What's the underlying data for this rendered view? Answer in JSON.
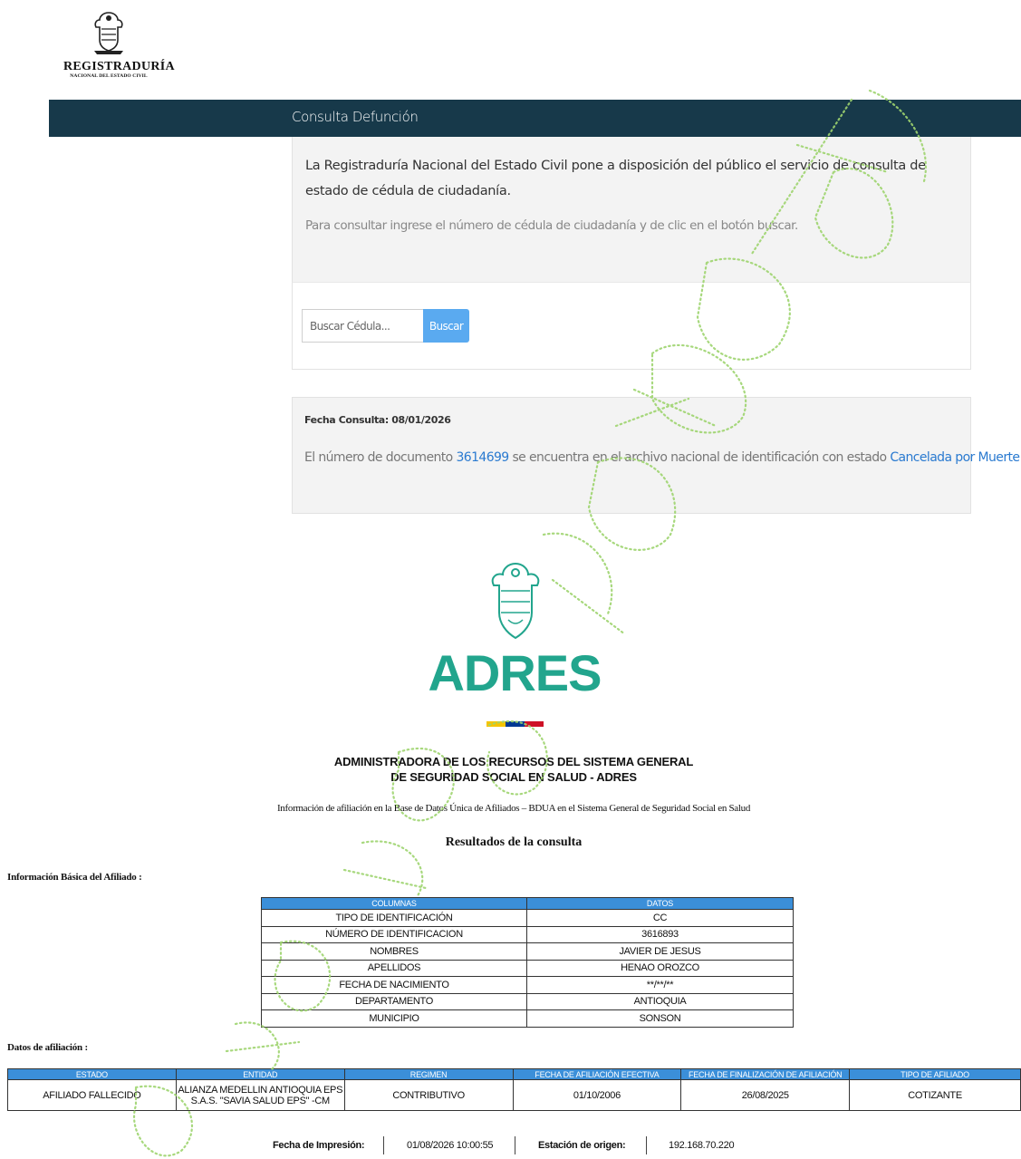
{
  "registraduria": {
    "logo_brand": "REGISTRADURÍA",
    "logo_sub": "NACIONAL DEL ESTADO CIVIL",
    "nav_title": "Consulta Defunción",
    "lead_text": "La Registraduría Nacional del Estado Civil pone a disposición del público el servicio de consulta de estado de cédula de ciudadanía.",
    "hint_text": "Para consultar ingrese el número de cédula de ciudadanía y de clic en el botón buscar.",
    "search_placeholder": "Buscar Cédula...",
    "search_button": "Buscar",
    "fecha_consulta": "Fecha Consulta: 08/01/2026",
    "result_prefix": "El número de documento",
    "result_doc": "3614699",
    "result_middle": "se encuentra en el archivo nacional de identificación con estado",
    "result_status": "Cancelada por Muerte"
  },
  "adres": {
    "logo_word": "ADRES",
    "flag_colors": [
      "#f5c400",
      "#003893",
      "#ce1126"
    ],
    "title_line1": "ADMINISTRADORA DE LOS RECURSOS DEL SISTEMA GENERAL",
    "title_line2": "DE SEGURIDAD SOCIAL EN SALUD - ADRES",
    "info_line": "Información de afiliación en la Base de Datos Única de Afiliados – BDUA en el Sistema General de Seguridad Social en Salud",
    "results_title": "Resultados de la consulta",
    "basic_info_label": "Información Básica del Afiliado :",
    "basic_table": {
      "headers": [
        "COLUMNAS",
        "DATOS"
      ],
      "rows": [
        [
          "TIPO DE IDENTIFICACIÓN",
          "CC"
        ],
        [
          "NÚMERO DE IDENTIFICACION",
          "3616893"
        ],
        [
          "NOMBRES",
          "JAVIER DE JESUS"
        ],
        [
          "APELLIDOS",
          "HENAO OROZCO"
        ],
        [
          "FECHA DE NACIMIENTO",
          "**/**/**"
        ],
        [
          "DEPARTAMENTO",
          "ANTIOQUIA"
        ],
        [
          "MUNICIPIO",
          "SONSON"
        ]
      ]
    },
    "affiliation_label": "Datos de afiliación :",
    "affiliation_table": {
      "headers": [
        "ESTADO",
        "ENTIDAD",
        "REGIMEN",
        "FECHA DE AFILIACIÓN EFECTIVA",
        "FECHA DE FINALIZACIÓN DE AFILIACIÓN",
        "TIPO DE AFILIADO"
      ],
      "row": [
        "AFILIADO FALLECIDO",
        "ALIANZA MEDELLIN ANTIOQUIA EPS S.A.S. \"SAVIA SALUD EPS\" -CM",
        "CONTRIBUTIVO",
        "01/10/2006",
        "26/08/2025",
        "COTIZANTE"
      ]
    },
    "footer": {
      "print_label": "Fecha de Impresión:",
      "print_value": "01/08/2026 10:00:55",
      "station_label": "Estación de origen:",
      "station_value": "192.168.70.220"
    }
  },
  "watermark_color": "#9ed46f"
}
